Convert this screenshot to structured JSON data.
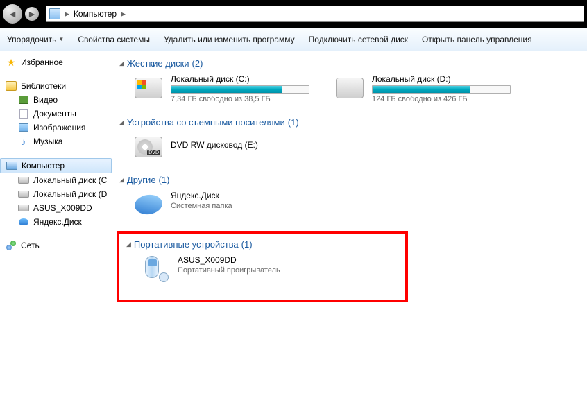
{
  "address": {
    "root": "Компьютер"
  },
  "toolbar": {
    "organize": "Упорядочить",
    "sysprops": "Свойства системы",
    "uninstall": "Удалить или изменить программу",
    "mapnet": "Подключить сетевой диск",
    "controlpanel": "Открыть панель управления"
  },
  "sidebar": {
    "favorites": "Избранное",
    "libraries": "Библиотеки",
    "lib_items": {
      "video": "Видео",
      "docs": "Документы",
      "images": "Изображения",
      "music": "Музыка"
    },
    "computer": "Компьютер",
    "comp_items": {
      "c": "Локальный диск (C",
      "d": "Локальный диск (D",
      "asus": "ASUS_X009DD",
      "yd": "Яндекс.Диск"
    },
    "network": "Сеть"
  },
  "sections": {
    "hdd": {
      "title": "Жесткие диски",
      "count": "(2)"
    },
    "removable": {
      "title": "Устройства со съемными носителями",
      "count": "(1)"
    },
    "other": {
      "title": "Другие",
      "count": "(1)"
    },
    "portable": {
      "title": "Портативные устройства",
      "count": "(1)"
    }
  },
  "drives": {
    "c": {
      "name": "Локальный диск (C:)",
      "free": "7,34 ГБ свободно из 38,5 ГБ",
      "pct": 81
    },
    "d": {
      "name": "Локальный диск (D:)",
      "free": "124 ГБ свободно из 426 ГБ",
      "pct": 71
    },
    "dvd": {
      "name": "DVD RW дисковод (E:)",
      "badge": "DVD"
    },
    "yd": {
      "name": "Яндекс.Диск",
      "sub": "Системная папка"
    },
    "asus": {
      "name": "ASUS_X009DD",
      "sub": "Портативный проигрыватель"
    }
  }
}
